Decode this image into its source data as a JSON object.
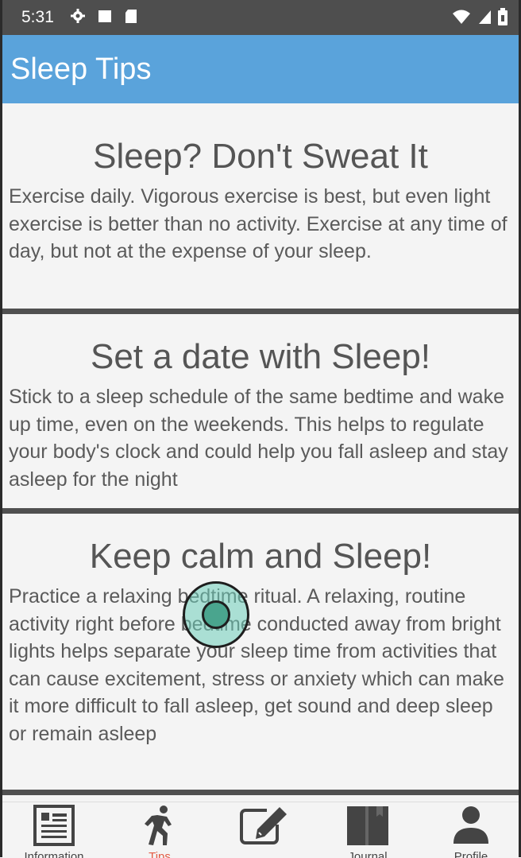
{
  "status_bar": {
    "time": "5:31",
    "icons_left": [
      "gear-icon",
      "square-icon",
      "sd-card-icon"
    ],
    "icons_right": [
      "wifi-icon",
      "signal-icon",
      "battery-icon"
    ]
  },
  "app_bar": {
    "title": "Sleep Tips",
    "color": "#5aa3db"
  },
  "tips": [
    {
      "title": "Sleep? Don't Sweat It",
      "body": "Exercise daily. Vigorous exercise is best, but even light exercise is better than no activity. Exercise at any time of day, but not at the expense of your sleep."
    },
    {
      "title": "Set a date with Sleep!",
      "body": "Stick to a sleep schedule of the same bedtime and wake up time, even on the weekends. This helps to regulate your body's clock and could help you fall asleep and stay asleep for the night"
    },
    {
      "title": "Keep calm and Sleep!",
      "body": "Practice a relaxing bedtime ritual. A relaxing, routine activity right before bedtime conducted away from bright lights helps separate your sleep time from activities that can cause excitement, stress or anxiety which can make it more difficult to fall asleep, get sound and deep sleep or remain asleep"
    }
  ],
  "bottom_nav": {
    "active_color": "#e35b44",
    "items": [
      {
        "label": "Information",
        "icon": "newspaper-icon"
      },
      {
        "label": "Tips",
        "icon": "running-person-icon",
        "active": true
      },
      {
        "label": "",
        "icon": "edit-icon"
      },
      {
        "label": "Journal",
        "icon": "book-icon"
      },
      {
        "label": "Profile",
        "icon": "person-icon"
      }
    ]
  }
}
